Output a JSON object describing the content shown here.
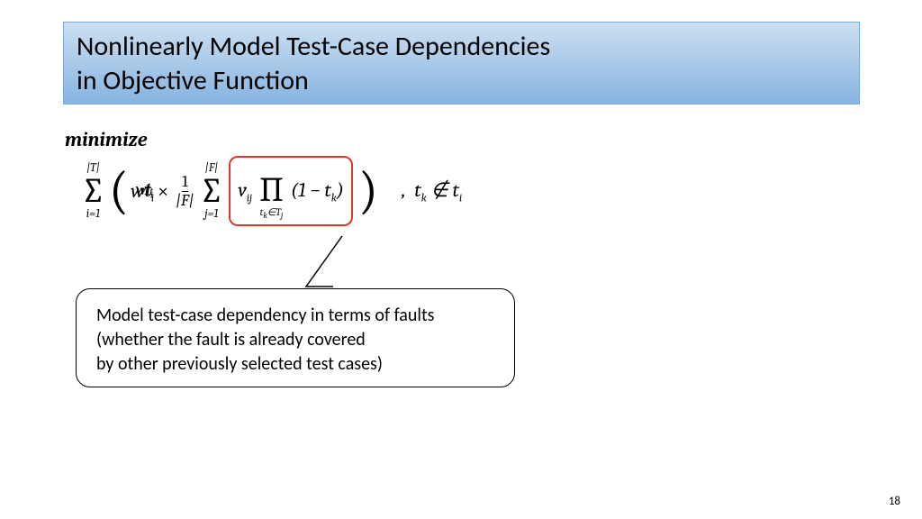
{
  "title": {
    "line1": "Nonlinearly Model Test-Case Dependencies",
    "line2": "in Objective Function"
  },
  "minimize": "minimize",
  "formula": {
    "sum_upper": "|T|",
    "sum_lower": "i=1",
    "w": "w",
    "t_i": "t",
    "t_i_sub": "i",
    "one": "1",
    "times": "×",
    "frac_num": "1",
    "frac_den": "|F|",
    "inner_sum_upper": "|F|",
    "inner_sum_lower": "j=1",
    "v": "v",
    "v_sub": "ij",
    "prod_lower": "t_k∈T_j",
    "one_minus": "(1 − t",
    "tk_sub": "k",
    "close_paren": ")",
    "condition": ",  t_k ∉ t_i"
  },
  "overlay_wt": "w1t_i × t_i",
  "callout": {
    "l1": "Model test-case dependency in terms of faults",
    "l2": "(whether the fault is already covered",
    "l3": " by other previously selected test cases)"
  },
  "page": "18"
}
